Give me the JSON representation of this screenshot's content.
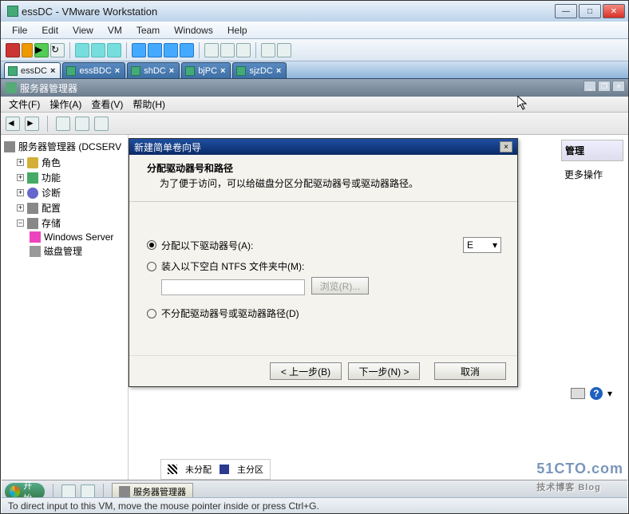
{
  "vm": {
    "title": "essDC - VMware Workstation",
    "menu": [
      "File",
      "Edit",
      "View",
      "VM",
      "Team",
      "Windows",
      "Help"
    ],
    "tabs": [
      {
        "label": "essDC",
        "active": true
      },
      {
        "label": "essBDC",
        "active": false
      },
      {
        "label": "shDC",
        "active": false
      },
      {
        "label": "bjPC",
        "active": false
      },
      {
        "label": "sjzDC",
        "active": false
      }
    ],
    "status": "To direct input to this VM, move the mouse pointer inside or press Ctrl+G."
  },
  "guest": {
    "title": "服务器管理器",
    "menu": {
      "file": "文件(F)",
      "action": "操作(A)",
      "view": "查看(V)",
      "help": "帮助(H)"
    },
    "tree": {
      "root": "服务器管理器 (DCSERV",
      "roles": "角色",
      "features": "功能",
      "diag": "诊断",
      "config": "配置",
      "storage": "存储",
      "wsb": "Windows Server",
      "disk": "磁盘管理"
    },
    "right": {
      "head": "管理",
      "more": "更多操作"
    },
    "legend": {
      "unalloc": "未分配",
      "primary": "主分区"
    }
  },
  "dlg": {
    "title": "新建简单卷向导",
    "head": "分配驱动器号和路径",
    "sub": "为了便于访问，可以给磁盘分区分配驱动器号或驱动器路径。",
    "opt1": "分配以下驱动器号(A):",
    "opt2": "装入以下空白 NTFS 文件夹中(M):",
    "opt3": "不分配驱动器号或驱动器路径(D)",
    "drive": "E",
    "browse": "浏览(R)...",
    "back": "< 上一步(B)",
    "next": "下一步(N) >",
    "cancel": "取消"
  },
  "taskbar": {
    "start": "开始",
    "server": "服务器管理器"
  },
  "watermark": "51CTO.com",
  "wm2": "技术博客  Blog"
}
